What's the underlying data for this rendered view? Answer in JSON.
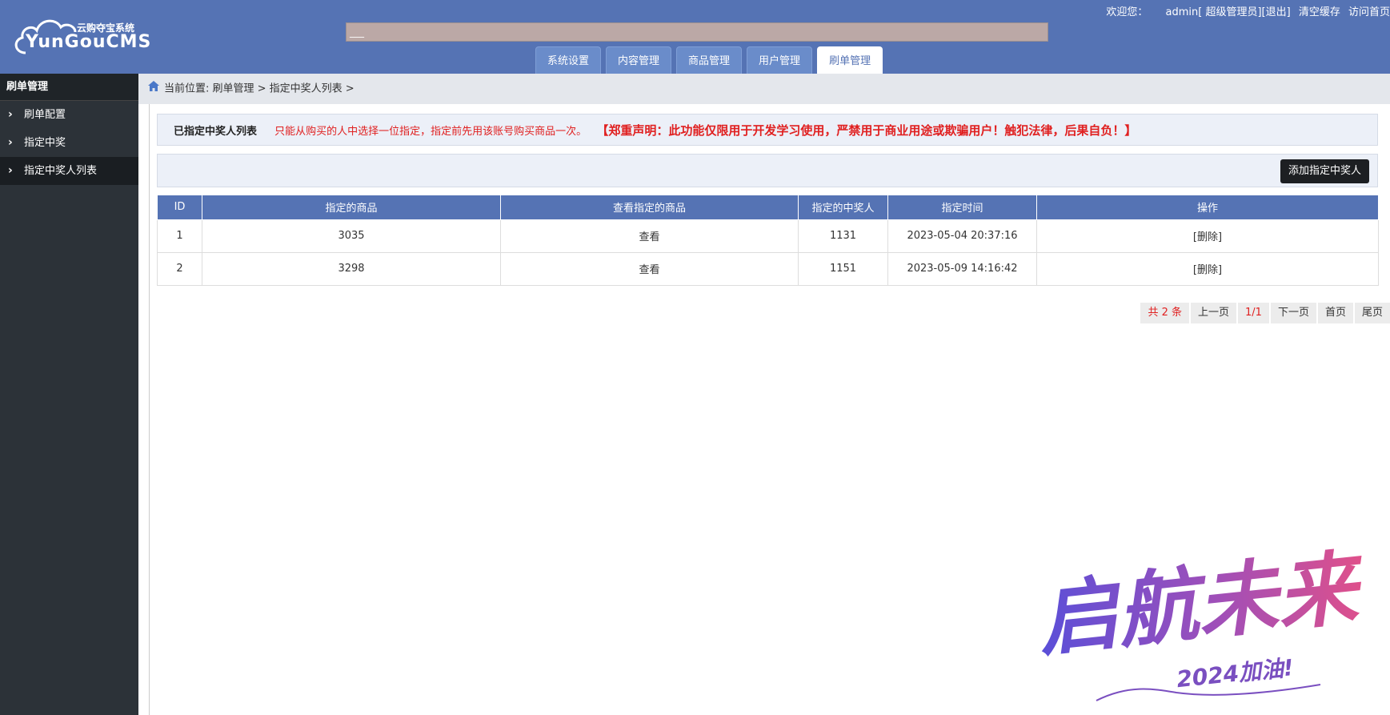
{
  "header": {
    "logo_sub": "云购夺宝系统",
    "logo_main": "YunGouCMS",
    "search_value": "___",
    "links": {
      "welcome": "欢迎您：",
      "user": "admin[ 超级管理员]",
      "logout": "[退出]",
      "clear_cache": "清空缓存",
      "visit_home": "访问首页"
    }
  },
  "nav": {
    "tabs": [
      {
        "label": "系统设置"
      },
      {
        "label": "内容管理"
      },
      {
        "label": "商品管理"
      },
      {
        "label": "用户管理"
      },
      {
        "label": "刷单管理"
      }
    ]
  },
  "sidebar": {
    "title": "刷单管理",
    "items": [
      {
        "label": "刷单配置"
      },
      {
        "label": "指定中奖"
      },
      {
        "label": "指定中奖人列表"
      }
    ]
  },
  "breadcrumb": {
    "text": "当前位置: 刷单管理 > 指定中奖人列表 >"
  },
  "info": {
    "title": "已指定中奖人列表",
    "hint": "只能从购买的人中选择一位指定，指定前先用该账号购买商品一次。",
    "warning": "【郑重声明：此功能仅限用于开发学习使用，严禁用于商业用途或欺骗用户！触犯法律，后果自负！】"
  },
  "toolbar": {
    "add_label": "添加指定中奖人"
  },
  "table": {
    "headers": [
      "ID",
      "指定的商品",
      "查看指定的商品",
      "指定的中奖人",
      "指定时间",
      "操作"
    ],
    "rows": [
      {
        "id": "1",
        "product": "3035",
        "view": "查看",
        "winner": "1131",
        "time": "2023-05-04 20:37:16",
        "action": "[删除]"
      },
      {
        "id": "2",
        "product": "3298",
        "view": "查看",
        "winner": "1151",
        "time": "2023-05-09 14:16:42",
        "action": "[删除]"
      }
    ]
  },
  "pager": {
    "total": "共 2 条",
    "prev": "上一页",
    "current": "1/1",
    "next": "下一页",
    "first": "首页",
    "last": "尾页"
  },
  "watermark": {
    "main": "启航未来",
    "sub": "2024加油!"
  },
  "colors": {
    "header_bg": "#5573b4",
    "sidebar_bg": "#2c3238",
    "warning_red": "#e02020"
  }
}
